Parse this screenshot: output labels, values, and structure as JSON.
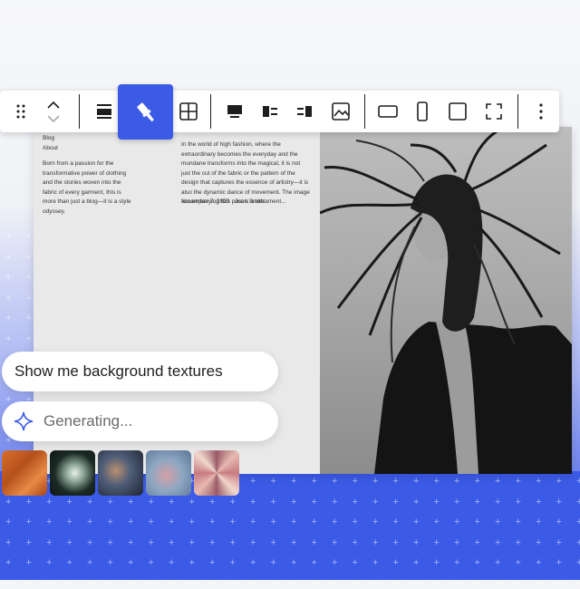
{
  "blog": {
    "nav": [
      "Blog",
      "About"
    ],
    "intro": "Born from a passion for the transformative power of clothing and the stories woven into the fabric of every garment, this is more than just a blog—it is a style odyssey.",
    "post_excerpt": "In the world of high fashion, where the extraordinary becomes the everyday and the mundane transforms into the magical, it is not just the cut of the fabric or the pattern of the design that captures the essence of artistry—it is also the dynamic dance of movement. The image accompanying this post is a testament...",
    "post_date": "November 7, 2023",
    "post_author": "Joan Smith"
  },
  "toolbar": {
    "buttons": [
      "drag-handle",
      "move-up-down",
      "align-wide",
      "paint-brush",
      "grid",
      "media-top",
      "media-left",
      "media-right",
      "image",
      "aspect-landscape",
      "aspect-portrait",
      "aspect-square",
      "fullscreen",
      "more-options"
    ]
  },
  "chat": {
    "prompt": "Show me background textures",
    "status": "Generating..."
  },
  "thumbnails": [
    "orange-texture",
    "green-texture",
    "dark-texture",
    "blue-texture",
    "pink-texture"
  ],
  "colors": {
    "accent": "#3b5ae6"
  }
}
